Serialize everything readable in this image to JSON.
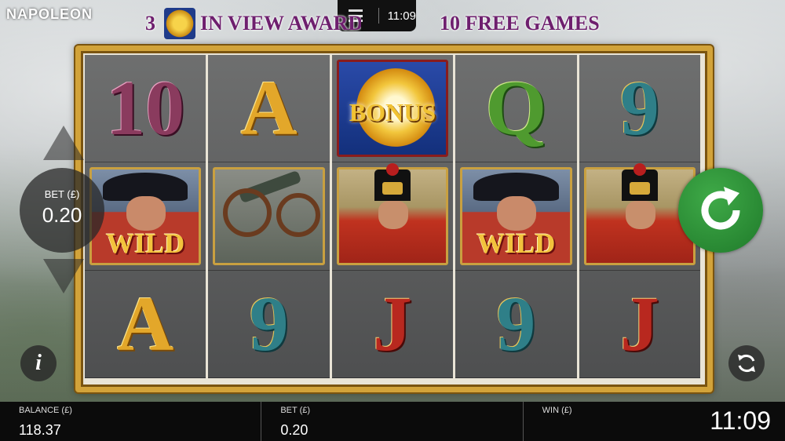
{
  "game": {
    "title": "NAPOLEON"
  },
  "status_bar": {
    "time": "11:09"
  },
  "banner": {
    "number": "3",
    "text_mid": "IN VIEW AWARDS",
    "text_end": "10 FREE GAMES"
  },
  "reels": [
    [
      {
        "type": "card",
        "text": "10",
        "color": "purple"
      },
      {
        "type": "wild",
        "label": "WILD"
      },
      {
        "type": "card",
        "text": "A",
        "color": "gold"
      }
    ],
    [
      {
        "type": "card",
        "text": "A",
        "color": "gold"
      },
      {
        "type": "cannon"
      },
      {
        "type": "card",
        "text": "9",
        "color": "teal"
      }
    ],
    [
      {
        "type": "bonus",
        "label": "BONUS"
      },
      {
        "type": "soldier"
      },
      {
        "type": "card",
        "text": "J",
        "color": "red"
      }
    ],
    [
      {
        "type": "card",
        "text": "Q",
        "color": "green"
      },
      {
        "type": "wild",
        "label": "WILD"
      },
      {
        "type": "card",
        "text": "9",
        "color": "teal"
      }
    ],
    [
      {
        "type": "card",
        "text": "9",
        "color": "teal"
      },
      {
        "type": "soldier"
      },
      {
        "type": "card",
        "text": "J",
        "color": "red"
      }
    ]
  ],
  "controls": {
    "bet_label": "BET (£)",
    "bet_value": "0.20",
    "info_icon": "i"
  },
  "footer": {
    "balance_label": "BALANCE (£)",
    "balance_value": "118.37",
    "bet_label": "BET (£)",
    "bet_value": "0.20",
    "win_label": "WIN (£)",
    "time": "11:09"
  },
  "icons": {
    "menu": "menu-icon",
    "spin": "spin-arrow-icon",
    "autoplay": "autoplay-icon",
    "info": "info-icon"
  }
}
